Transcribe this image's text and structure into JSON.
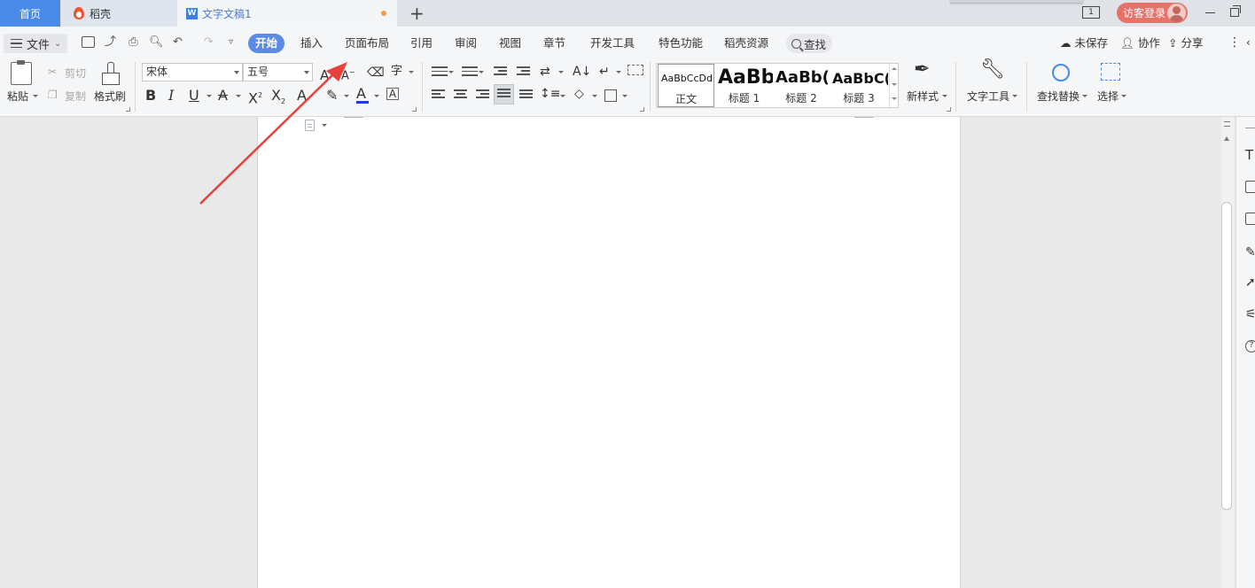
{
  "tabs": {
    "home": "首页",
    "daoke": "稻壳",
    "document": "文字文稿1"
  },
  "window": {
    "screen_count": "1",
    "login": "访客登录"
  },
  "menubar": {
    "file": "文件",
    "items": [
      "开始",
      "插入",
      "页面布局",
      "引用",
      "审阅",
      "视图",
      "章节",
      "开发工具",
      "特色功能",
      "稻壳资源"
    ],
    "search": "查找",
    "unsaved": "未保存",
    "collab": "协作",
    "share": "分享"
  },
  "ribbon": {
    "paste": "粘贴",
    "cut": "剪切",
    "copy": "复制",
    "format_painter": "格式刷",
    "font_name": "宋体",
    "font_size": "五号",
    "styles": [
      {
        "sample": "AaBbCcDd",
        "name": "正文"
      },
      {
        "sample": "AaBb",
        "name": "标题 1"
      },
      {
        "sample": "AaBb(",
        "name": "标题 2"
      },
      {
        "sample": "AaBbC(",
        "name": "标题 3"
      }
    ],
    "new_style": "新样式",
    "text_tools": "文字工具",
    "find_replace": "查找替换",
    "select": "选择"
  },
  "colors": {
    "accent": "#5b8be4",
    "home_tab": "#4b8ae8",
    "login_bg": "#e8716a",
    "annotation_arrow": "#e8413c",
    "font_color_bar": "#1a3fd8"
  }
}
